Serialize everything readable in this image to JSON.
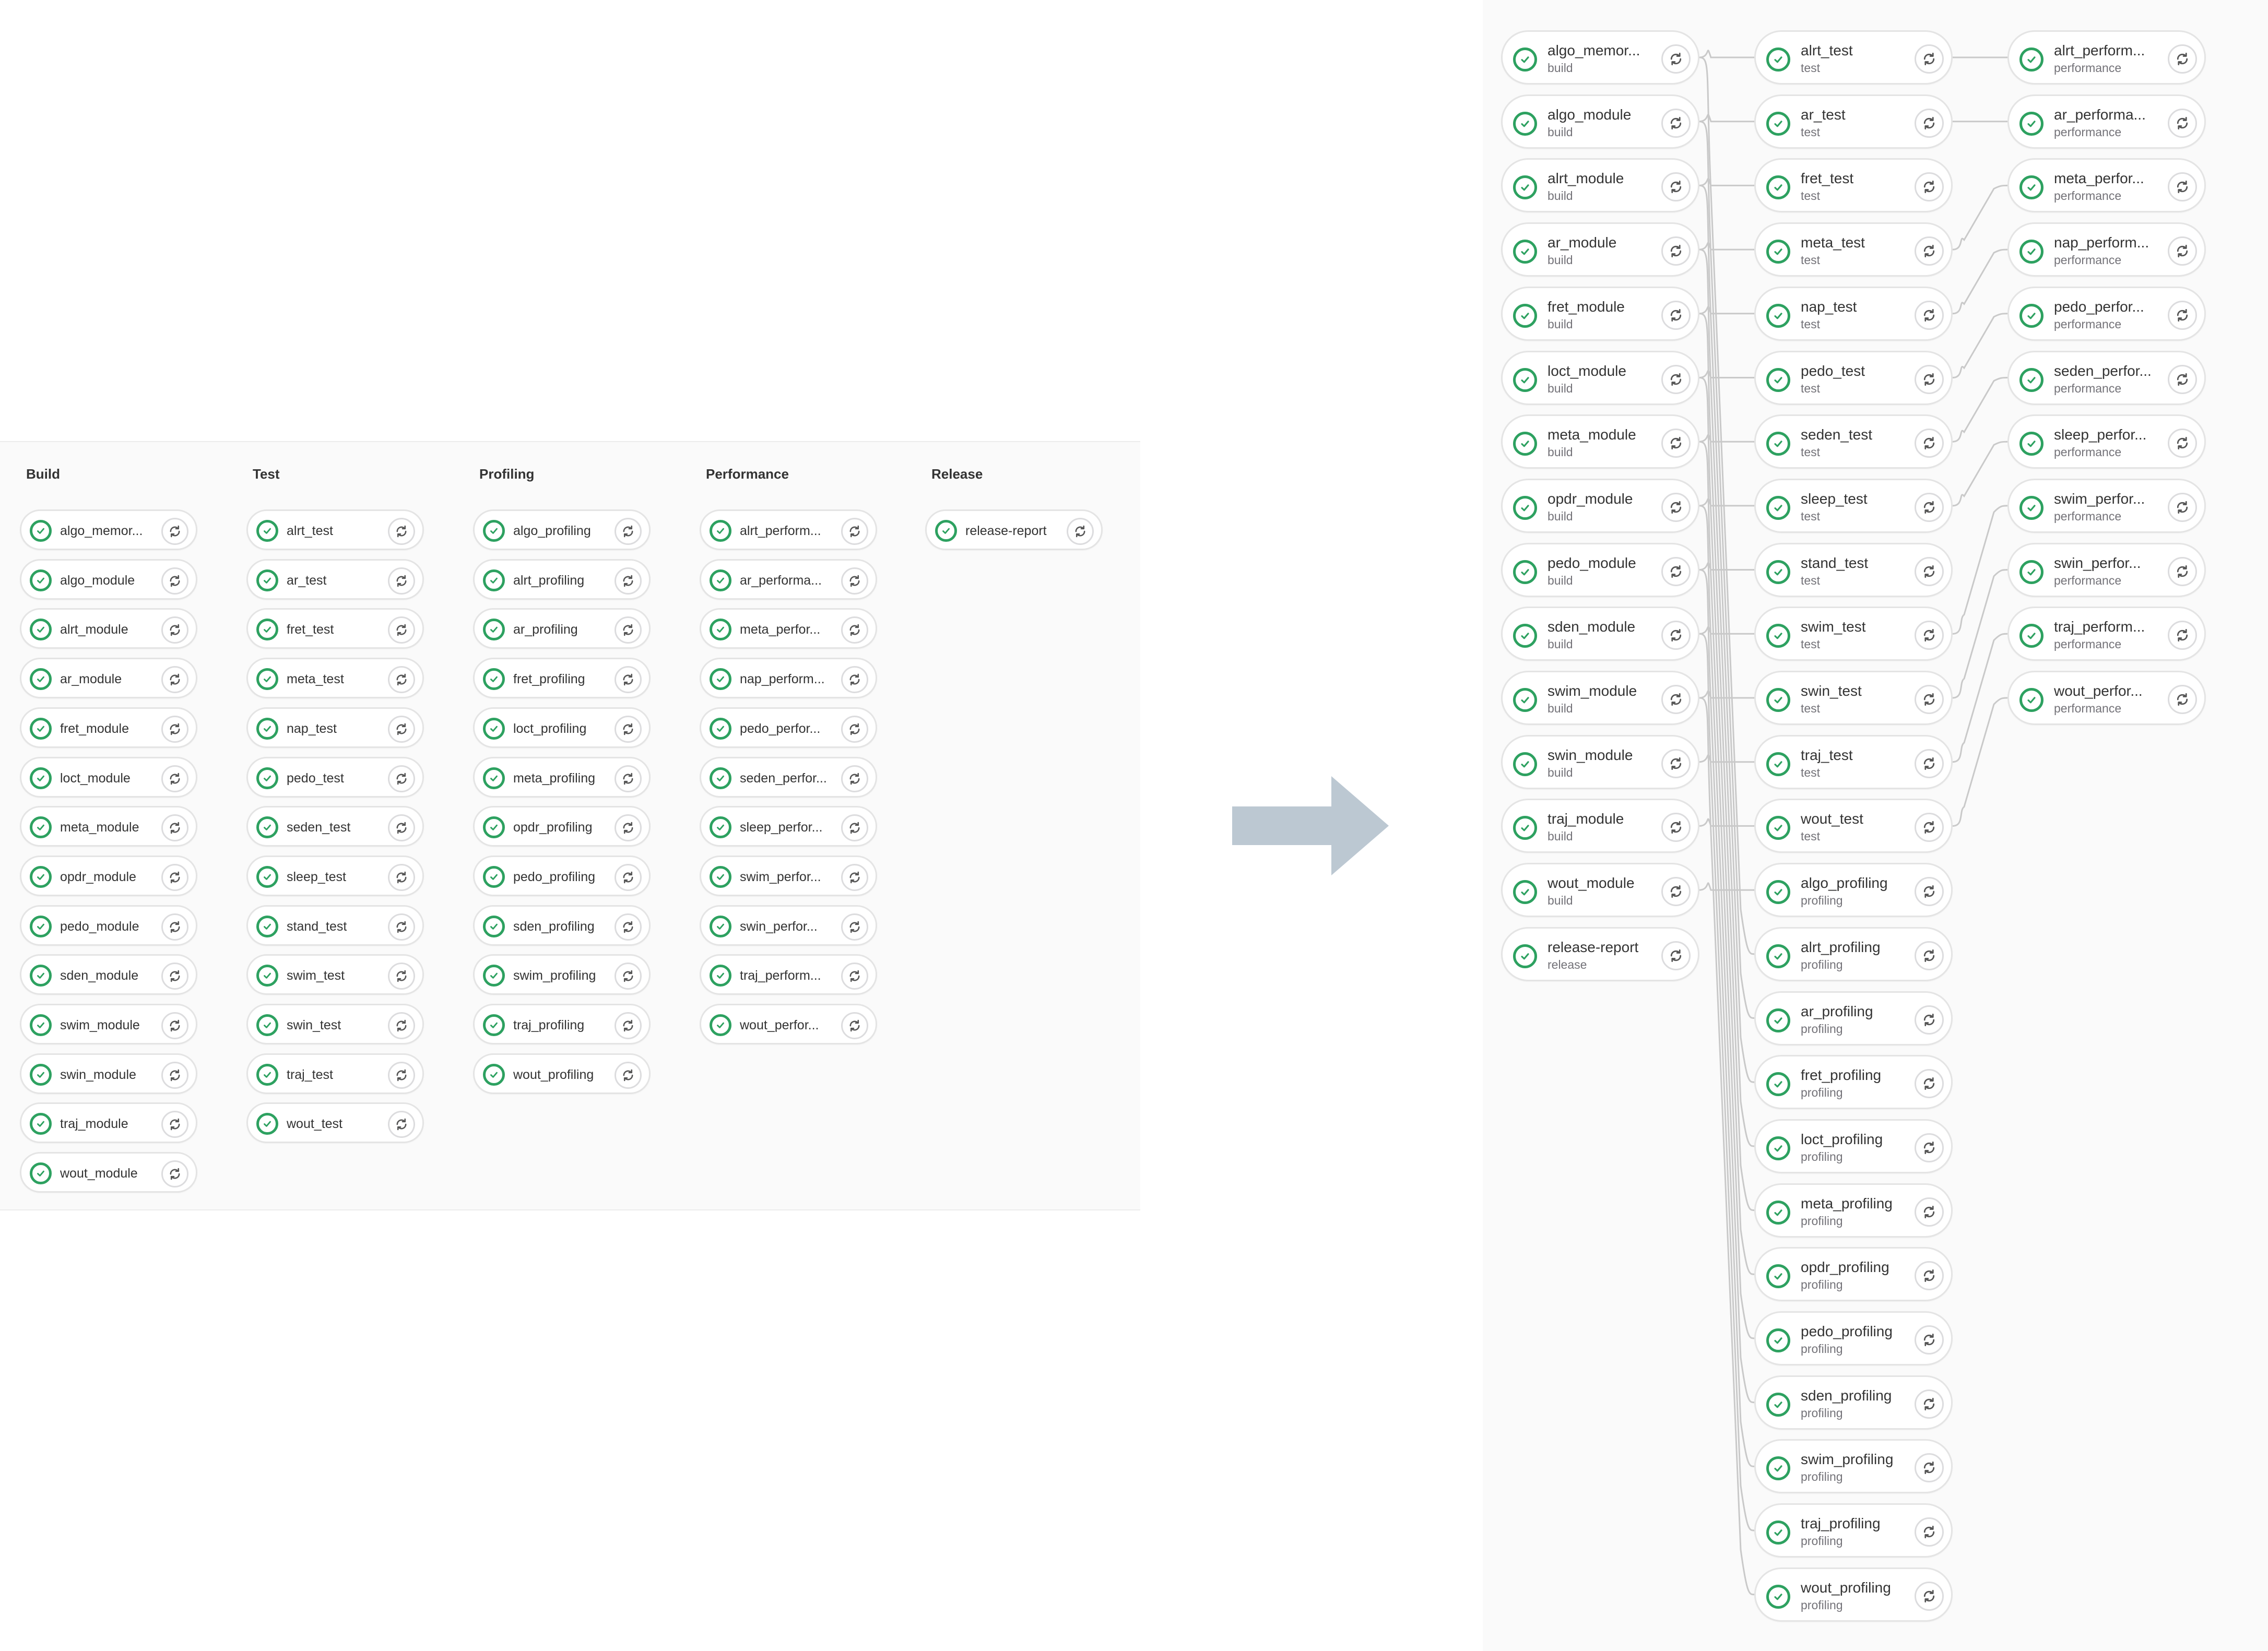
{
  "colors": {
    "success": "#2da160",
    "link": "#c9c9c9",
    "arrow": "#bcc8d2"
  },
  "icons": {
    "status": "check-circle-icon",
    "retry": "retry-icon",
    "arrow": "right-arrow-icon"
  },
  "stage_view": {
    "stages": [
      {
        "title": "Build",
        "jobs": [
          "algo_memor...",
          "algo_module",
          "alrt_module",
          "ar_module",
          "fret_module",
          "loct_module",
          "meta_module",
          "opdr_module",
          "pedo_module",
          "sden_module",
          "swim_module",
          "swin_module",
          "traj_module",
          "wout_module"
        ]
      },
      {
        "title": "Test",
        "jobs": [
          "alrt_test",
          "ar_test",
          "fret_test",
          "meta_test",
          "nap_test",
          "pedo_test",
          "seden_test",
          "sleep_test",
          "stand_test",
          "swim_test",
          "swin_test",
          "traj_test",
          "wout_test"
        ]
      },
      {
        "title": "Profiling",
        "jobs": [
          "algo_profiling",
          "alrt_profiling",
          "ar_profiling",
          "fret_profiling",
          "loct_profiling",
          "meta_profiling",
          "opdr_profiling",
          "pedo_profiling",
          "sden_profiling",
          "swim_profiling",
          "traj_profiling",
          "wout_profiling"
        ]
      },
      {
        "title": "Performance",
        "jobs": [
          "alrt_perform...",
          "ar_performa...",
          "meta_perfor...",
          "nap_perform...",
          "pedo_perfor...",
          "seden_perfor...",
          "sleep_perfor...",
          "swim_perfor...",
          "swin_perfor...",
          "traj_perform...",
          "wout_perfor..."
        ]
      },
      {
        "title": "Release",
        "jobs": [
          "release-report"
        ]
      }
    ]
  },
  "graph_view": {
    "columns": [
      {
        "jobs": [
          {
            "name": "algo_memor...",
            "stage": "build"
          },
          {
            "name": "algo_module",
            "stage": "build"
          },
          {
            "name": "alrt_module",
            "stage": "build"
          },
          {
            "name": "ar_module",
            "stage": "build"
          },
          {
            "name": "fret_module",
            "stage": "build"
          },
          {
            "name": "loct_module",
            "stage": "build"
          },
          {
            "name": "meta_module",
            "stage": "build"
          },
          {
            "name": "opdr_module",
            "stage": "build"
          },
          {
            "name": "pedo_module",
            "stage": "build"
          },
          {
            "name": "sden_module",
            "stage": "build"
          },
          {
            "name": "swim_module",
            "stage": "build"
          },
          {
            "name": "swin_module",
            "stage": "build"
          },
          {
            "name": "traj_module",
            "stage": "build"
          },
          {
            "name": "wout_module",
            "stage": "build"
          },
          {
            "name": "release-report",
            "stage": "release"
          }
        ]
      },
      {
        "jobs": [
          {
            "name": "alrt_test",
            "stage": "test"
          },
          {
            "name": "ar_test",
            "stage": "test"
          },
          {
            "name": "fret_test",
            "stage": "test"
          },
          {
            "name": "meta_test",
            "stage": "test"
          },
          {
            "name": "nap_test",
            "stage": "test"
          },
          {
            "name": "pedo_test",
            "stage": "test"
          },
          {
            "name": "seden_test",
            "stage": "test"
          },
          {
            "name": "sleep_test",
            "stage": "test"
          },
          {
            "name": "stand_test",
            "stage": "test"
          },
          {
            "name": "swim_test",
            "stage": "test"
          },
          {
            "name": "swin_test",
            "stage": "test"
          },
          {
            "name": "traj_test",
            "stage": "test"
          },
          {
            "name": "wout_test",
            "stage": "test"
          },
          {
            "name": "algo_profiling",
            "stage": "profiling"
          },
          {
            "name": "alrt_profiling",
            "stage": "profiling"
          },
          {
            "name": "ar_profiling",
            "stage": "profiling"
          },
          {
            "name": "fret_profiling",
            "stage": "profiling"
          },
          {
            "name": "loct_profiling",
            "stage": "profiling"
          },
          {
            "name": "meta_profiling",
            "stage": "profiling"
          },
          {
            "name": "opdr_profiling",
            "stage": "profiling"
          },
          {
            "name": "pedo_profiling",
            "stage": "profiling"
          },
          {
            "name": "sden_profiling",
            "stage": "profiling"
          },
          {
            "name": "swim_profiling",
            "stage": "profiling"
          },
          {
            "name": "traj_profiling",
            "stage": "profiling"
          },
          {
            "name": "wout_profiling",
            "stage": "profiling"
          }
        ]
      },
      {
        "jobs": [
          {
            "name": "alrt_perform...",
            "stage": "performance"
          },
          {
            "name": "ar_performa...",
            "stage": "performance"
          },
          {
            "name": "meta_perfor...",
            "stage": "performance"
          },
          {
            "name": "nap_perform...",
            "stage": "performance"
          },
          {
            "name": "pedo_perfor...",
            "stage": "performance"
          },
          {
            "name": "seden_perfor...",
            "stage": "performance"
          },
          {
            "name": "sleep_perfor...",
            "stage": "performance"
          },
          {
            "name": "swim_perfor...",
            "stage": "performance"
          },
          {
            "name": "swin_perfor...",
            "stage": "performance"
          },
          {
            "name": "traj_perform...",
            "stage": "performance"
          },
          {
            "name": "wout_perfor...",
            "stage": "performance"
          }
        ]
      }
    ]
  }
}
